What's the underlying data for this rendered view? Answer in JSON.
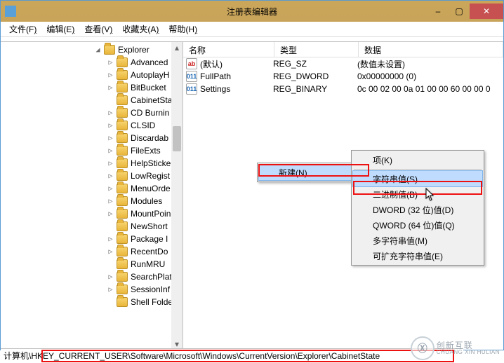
{
  "window": {
    "title": "注册表编辑器",
    "minimize": "–",
    "maximize": "▢",
    "close": "✕"
  },
  "menubar": [
    {
      "label": "文件",
      "accel": "F"
    },
    {
      "label": "编辑",
      "accel": "E"
    },
    {
      "label": "查看",
      "accel": "V"
    },
    {
      "label": "收藏夹",
      "accel": "A"
    },
    {
      "label": "帮助",
      "accel": "H"
    }
  ],
  "tree": {
    "parent": {
      "label": "Explorer",
      "expanded": true
    },
    "children": [
      {
        "label": "Advanced",
        "exp": true
      },
      {
        "label": "AutoplayH",
        "exp": true
      },
      {
        "label": "BitBucket",
        "exp": true
      },
      {
        "label": "CabinetSta",
        "exp": false
      },
      {
        "label": "CD Burnin",
        "exp": true
      },
      {
        "label": "CLSID",
        "exp": true
      },
      {
        "label": "Discardab",
        "exp": true
      },
      {
        "label": "FileExts",
        "exp": true
      },
      {
        "label": "HelpSticke",
        "exp": true
      },
      {
        "label": "LowRegist",
        "exp": true
      },
      {
        "label": "MenuOrde",
        "exp": true
      },
      {
        "label": "Modules",
        "exp": true
      },
      {
        "label": "MountPoin",
        "exp": true
      },
      {
        "label": "NewShort",
        "exp": false
      },
      {
        "label": "Package I",
        "exp": true
      },
      {
        "label": "RecentDo",
        "exp": true
      },
      {
        "label": "RunMRU",
        "exp": false
      },
      {
        "label": "SearchPlat",
        "exp": true
      },
      {
        "label": "SessionInf",
        "exp": true
      },
      {
        "label": "Shell Folde",
        "exp": false
      }
    ]
  },
  "list": {
    "columns": {
      "name": "名称",
      "type": "类型",
      "data": "数据"
    },
    "rows": [
      {
        "icon": "str",
        "name": "(默认)",
        "type": "REG_SZ",
        "data": "(数值未设置)"
      },
      {
        "icon": "bin",
        "name": "FullPath",
        "type": "REG_DWORD",
        "data": "0x00000000 (0)"
      },
      {
        "icon": "bin",
        "name": "Settings",
        "type": "REG_BINARY",
        "data": "0c 00 02 00 0a 01 00 00 60 00 00 0"
      }
    ]
  },
  "context": {
    "new_label": "新建(N)",
    "items": [
      {
        "label": "项(K)"
      },
      {
        "sep": true
      },
      {
        "label": "字符串值(S)",
        "hl": true
      },
      {
        "label": "二进制值(B)"
      },
      {
        "label": "DWORD (32 位)值(D)"
      },
      {
        "label": "QWORD (64 位)值(Q)"
      },
      {
        "label": "多字符串值(M)"
      },
      {
        "label": "可扩充字符串值(E)"
      }
    ]
  },
  "statusbar": {
    "path": "计算机\\HKEY_CURRENT_USER\\Software\\Microsoft\\Windows\\CurrentVersion\\Explorer\\CabinetState"
  },
  "watermark": {
    "cn": "创新互联",
    "en": "CHUANG XIN HULIAN"
  }
}
